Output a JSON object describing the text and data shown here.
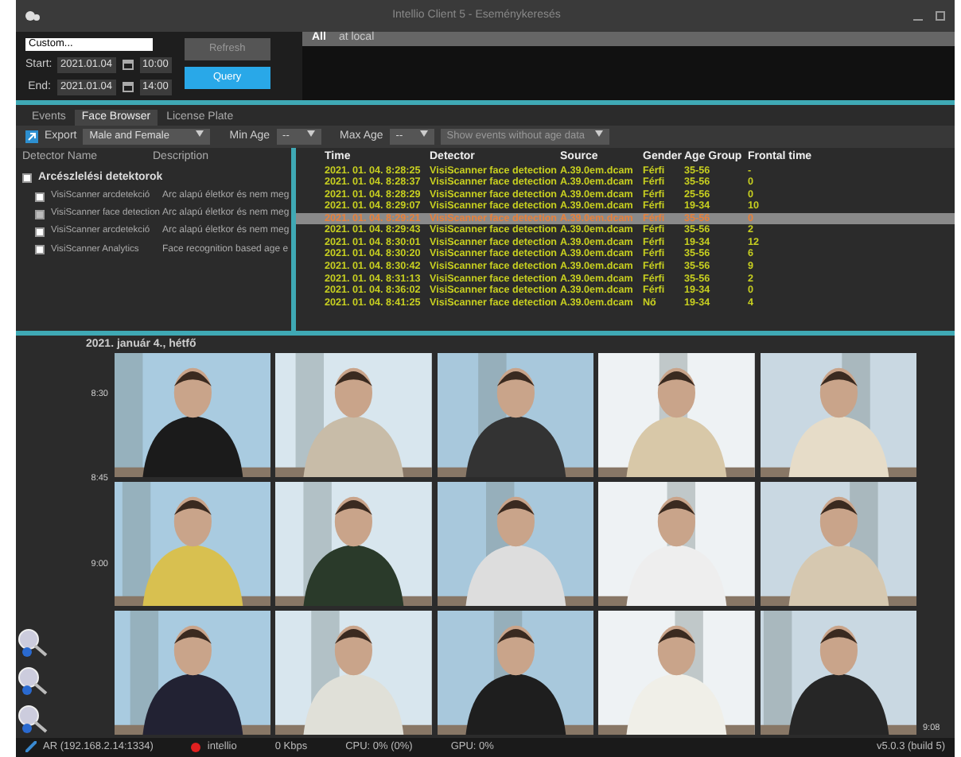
{
  "window": {
    "title": "Intellio Client 5 - Eseménykeresés"
  },
  "query": {
    "preset": "Custom...",
    "start_label": "Start:",
    "start_date": "2021.01.04",
    "start_time": "10:00",
    "end_label": "End:",
    "end_date": "2021.01.04",
    "end_time": "14:00",
    "refresh": "Refresh",
    "query_button": "Query"
  },
  "source_tabs": [
    {
      "label": "All",
      "selected": true
    },
    {
      "label": "at local",
      "selected": false
    }
  ],
  "tabs": [
    {
      "label": "Events",
      "selected": false
    },
    {
      "label": "Face Browser",
      "selected": true
    },
    {
      "label": "License Plate",
      "selected": false
    }
  ],
  "toolbar": {
    "export": "Export",
    "gender": "Male and Female",
    "min_age_label": "Min Age",
    "min_age": "--",
    "max_age_label": "Max Age",
    "max_age": "--",
    "filter": "Show events without age data"
  },
  "detectors": {
    "columns": [
      "Detector Name",
      "Description"
    ],
    "items": [
      {
        "name": "Arcészlelési detektorok",
        "checked": false,
        "children": [
          {
            "name": "VisiScanner arcdetekció",
            "description": "Arc alapú életkor és nem meg",
            "checked": false
          },
          {
            "name": "VisiScanner face detection",
            "description": "Arc alapú életkor és nem meg",
            "checked": true
          },
          {
            "name": "VisiScanner arcdetekció",
            "description": "Arc alapú életkor és nem meg",
            "checked": false
          },
          {
            "name": "VisiScanner Analytics",
            "description": "Face recognition based age e",
            "checked": false
          }
        ]
      }
    ]
  },
  "events": {
    "columns": [
      "Time",
      "Detector",
      "Source",
      "Gender",
      "Age Group",
      "Frontal time"
    ],
    "rows": [
      {
        "cells": [
          "2021. 01. 04. 8:28:25",
          "VisiScanner face detection",
          "A.39.0em.dcam",
          "Férfi",
          "35-56",
          "-"
        ],
        "selected": false
      },
      {
        "cells": [
          "2021. 01. 04. 8:28:37",
          "VisiScanner face detection",
          "A.39.0em.dcam",
          "Férfi",
          "35-56",
          "0"
        ],
        "selected": false
      },
      {
        "cells": [
          "2021. 01. 04. 8:28:29",
          "VisiScanner face detection",
          "A.39.0em.dcam",
          "Férfi",
          "25-56",
          "0"
        ],
        "selected": false
      },
      {
        "cells": [
          "2021. 01. 04. 8:29:07",
          "VisiScanner face detection",
          "A.39.0em.dcam",
          "Férfi",
          "19-34",
          "10"
        ],
        "selected": false
      },
      {
        "cells": [
          "2021. 01. 04. 8:29:21",
          "VisiScanner face detection",
          "A.39.0em.dcam",
          "Férfi",
          "35-56",
          "0"
        ],
        "selected": true
      },
      {
        "cells": [
          "2021. 01. 04. 8:29:43",
          "VisiScanner face detection",
          "A.39.0em.dcam",
          "Férfi",
          "35-56",
          "2"
        ],
        "selected": false
      },
      {
        "cells": [
          "2021. 01. 04. 8:30:01",
          "VisiScanner face detection",
          "A.39.0em.dcam",
          "Férfi",
          "19-34",
          "12"
        ],
        "selected": false
      },
      {
        "cells": [
          "2021. 01. 04. 8:30:20",
          "VisiScanner face detection",
          "A.39.0em.dcam",
          "Férfi",
          "35-56",
          "6"
        ],
        "selected": false
      },
      {
        "cells": [
          "2021. 01. 04. 8:30:42",
          "VisiScanner face detection",
          "A.39.0em.dcam",
          "Férfi",
          "35-56",
          "9"
        ],
        "selected": false
      },
      {
        "cells": [
          "2021. 01. 04. 8:31:13",
          "VisiScanner face detection",
          "A.39.0em.dcam",
          "Férfi",
          "35-56",
          "2"
        ],
        "selected": false
      },
      {
        "cells": [
          "2021. 01. 04. 8:36:02",
          "VisiScanner face detection",
          "A.39.0em.dcam",
          "Férfi",
          "19-34",
          "0"
        ],
        "selected": false
      },
      {
        "cells": [
          "2021. 01. 04. 8:41:25",
          "VisiScanner face detection",
          "A.39.0em.dcam",
          "Nő",
          "19-34",
          "4"
        ],
        "selected": false
      }
    ]
  },
  "browser": {
    "date": "2021. január 4., hétfő",
    "row_times": [
      "8:30",
      "8:45",
      "9:00"
    ],
    "end_time": "9:08",
    "thumbnails": [
      {
        "kind": "picture"
      },
      {
        "kind": "picture"
      },
      {
        "kind": "picture"
      },
      {
        "kind": "picture"
      },
      {
        "kind": "picture"
      },
      {
        "kind": "picture"
      },
      {
        "kind": "picture"
      },
      {
        "kind": "picture"
      },
      {
        "kind": "picture"
      },
      {
        "kind": "picture"
      },
      {
        "kind": "picture"
      },
      {
        "kind": "picture"
      },
      {
        "kind": "picture"
      },
      {
        "kind": "picture"
      },
      {
        "kind": "picture"
      }
    ]
  },
  "status_bar": {
    "connection": "AR (192.168.2.14:1334)",
    "server": "intellio",
    "bandwidth": "0 Kbps",
    "cpu": "CPU: 0% (0%)",
    "gpu": "GPU: 0%",
    "version": "v5.0.3 (build 5)"
  }
}
